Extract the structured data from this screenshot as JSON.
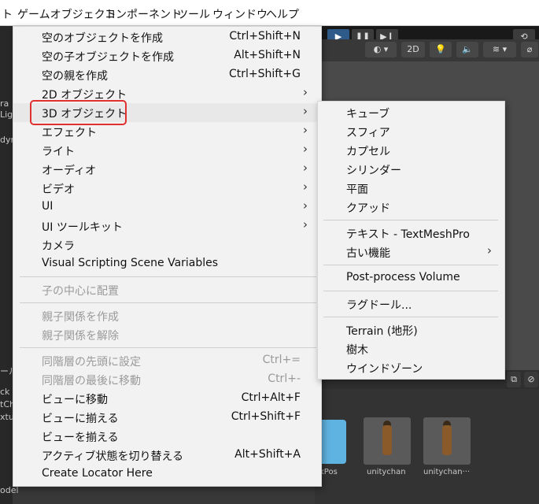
{
  "menubar": {
    "items": [
      "ト",
      "ゲームオブジェクト",
      "コンポーネント",
      "ツール",
      "ウィンドウ",
      "ヘルプ"
    ]
  },
  "scene_toolbar": {
    "mode_2d": "2D"
  },
  "left_panel": {
    "texts": [
      "ra",
      "Lig",
      "dyn",
      "ール",
      "ck",
      "tCh",
      "xtu",
      "odel"
    ]
  },
  "gameobject_menu": {
    "items": [
      {
        "label": "空のオブジェクトを作成",
        "shortcut": "Ctrl+Shift+N"
      },
      {
        "label": "空の子オブジェクトを作成",
        "shortcut": "Alt+Shift+N"
      },
      {
        "label": "空の親を作成",
        "shortcut": "Ctrl+Shift+G"
      },
      {
        "label": "2D オブジェクト"
      },
      {
        "label": "3D オブジェクト"
      },
      {
        "label": "エフェクト"
      },
      {
        "label": "ライト"
      },
      {
        "label": "オーディオ"
      },
      {
        "label": "ビデオ"
      },
      {
        "label": "UI"
      },
      {
        "label": "UI ツールキット"
      },
      {
        "label": "カメラ"
      },
      {
        "label": "Visual Scripting Scene Variables"
      },
      {
        "label": "子の中心に配置"
      },
      {
        "label": "親子関係を作成"
      },
      {
        "label": "親子関係を解除"
      },
      {
        "label": "同階層の先頭に設定",
        "shortcut": "Ctrl+="
      },
      {
        "label": "同階層の最後に移動",
        "shortcut": "Ctrl+-"
      },
      {
        "label": "ビューに移動",
        "shortcut": "Ctrl+Alt+F"
      },
      {
        "label": "ビューに揃える",
        "shortcut": "Ctrl+Shift+F"
      },
      {
        "label": "ビューを揃える"
      },
      {
        "label": "アクティブ状態を切り替える",
        "shortcut": "Alt+Shift+A"
      },
      {
        "label": "Create Locator Here"
      }
    ]
  },
  "submenu_3d": {
    "items": [
      "キューブ",
      "スフィア",
      "カプセル",
      "シリンダー",
      "平面",
      "クアッド",
      "テキスト - TextMeshPro",
      "古い機能",
      "Post-process Volume",
      "ラグドール...",
      "Terrain (地形)",
      "樹木",
      "ウインドゾーン"
    ]
  },
  "project": {
    "assets": [
      "kPos",
      "unitychan",
      "unitychan···"
    ]
  }
}
